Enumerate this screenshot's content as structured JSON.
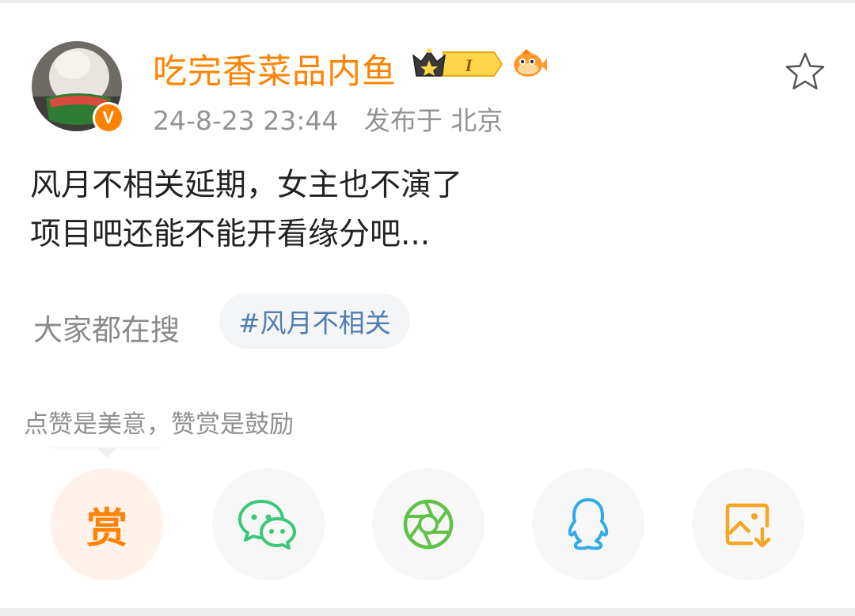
{
  "post": {
    "author": "吃完香菜品内鱼",
    "date": "24-8-23 23:44",
    "location": "发布于 北京",
    "verified_mark": "V",
    "level_badge": "I",
    "content_lines": [
      "风月不相关延期，女主也不演了",
      "项目吧还能不能开看缘分吧..."
    ]
  },
  "trending": {
    "label": "大家都在搜",
    "topic": "#风月不相关"
  },
  "reward": {
    "hint": "点赞是美意，赞赏是鼓励",
    "button_label": "赏"
  },
  "share_icons": [
    "reward-icon",
    "wechat-icon",
    "moments-icon",
    "qq-icon",
    "save-image-icon"
  ],
  "colors": {
    "brand_orange": "#ff8200",
    "topic_blue": "#507daf",
    "wechat_green": "#3bc77a",
    "moments_green": "#5fc246",
    "qq_blue": "#2fa9e8",
    "save_orange": "#f5a623"
  }
}
